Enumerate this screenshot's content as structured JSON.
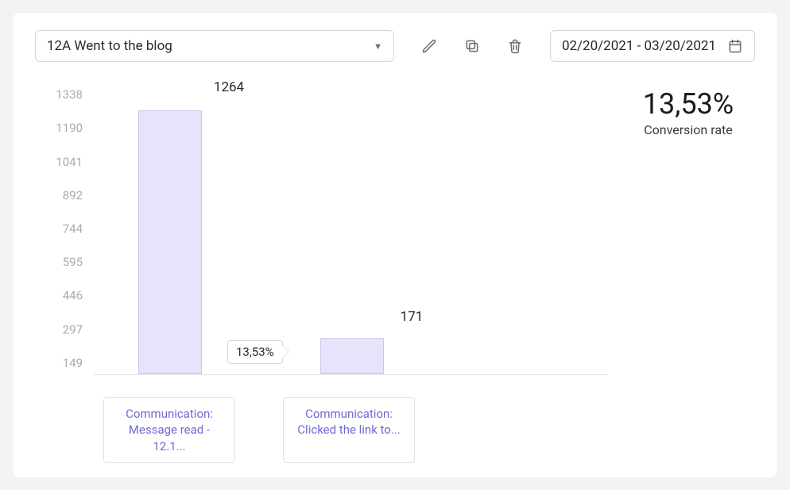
{
  "toolbar": {
    "select_value": "12A Went to the blog",
    "date_range": "02/20/2021 - 03/20/2021"
  },
  "chart_data": {
    "type": "bar",
    "categories": [
      "Communication: Message read - 12.1...",
      "Communication: Clicked the link to..."
    ],
    "values": [
      1264,
      171
    ],
    "ylim": [
      0,
      1338
    ],
    "y_ticks": [
      149,
      297,
      446,
      595,
      744,
      892,
      1041,
      1190,
      1338
    ],
    "step_rate_label": "13,53%",
    "xlabel": "",
    "ylabel": "",
    "title": ""
  },
  "stats": {
    "value": "13,53%",
    "label": "Conversion rate"
  }
}
